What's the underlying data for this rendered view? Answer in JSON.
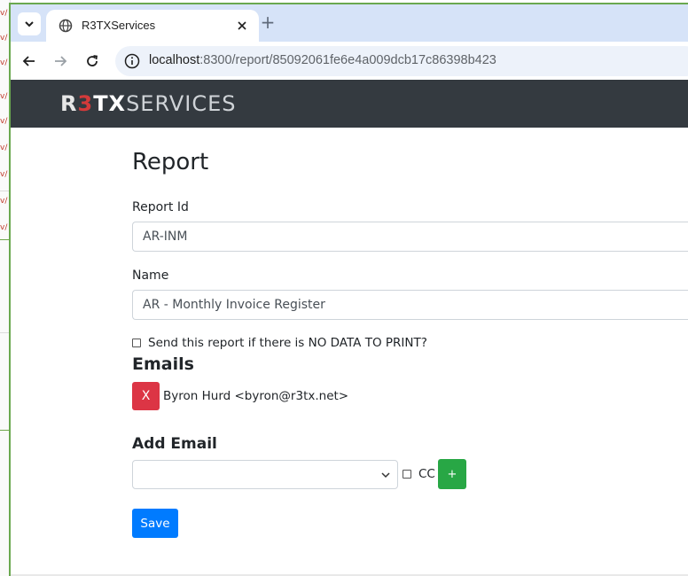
{
  "browser": {
    "tab_title": "R3TXServices",
    "new_tab_glyph": "+",
    "url_host": "localhost",
    "url_rest": ":8300/report/85092061fe6e4a009dcb17c86398b423",
    "icons": [
      "tab-search-icon",
      "globe-icon",
      "close-icon",
      "plus-icon",
      "back-arrow-icon",
      "forward-arrow-icon",
      "reload-icon",
      "site-info-icon"
    ]
  },
  "navbar": {
    "brand_r": "R",
    "brand_3": "3",
    "brand_tx": "TX",
    "brand_services": "SERVICES"
  },
  "form": {
    "title": "Report",
    "report_id_label": "Report Id",
    "report_id_value": "AR-INM",
    "name_label": "Name",
    "name_value": "AR - Monthly Invoice Register",
    "nodata_label": "Send this report if there is NO DATA TO PRINT?",
    "emails_heading": "Emails",
    "emails": [
      {
        "remove_label": "X",
        "entry": "Byron Hurd <byron@r3tx.net>"
      }
    ],
    "add_email_heading": "Add Email",
    "add_email_selected": "",
    "cc_label": "CC",
    "add_button_label": "+",
    "save_label": "Save"
  },
  "colors": {
    "navbar_bg": "#343a40",
    "danger": "#dc3545",
    "success": "#28a745",
    "primary": "#007bff",
    "brand_accent": "#d43a3a"
  }
}
